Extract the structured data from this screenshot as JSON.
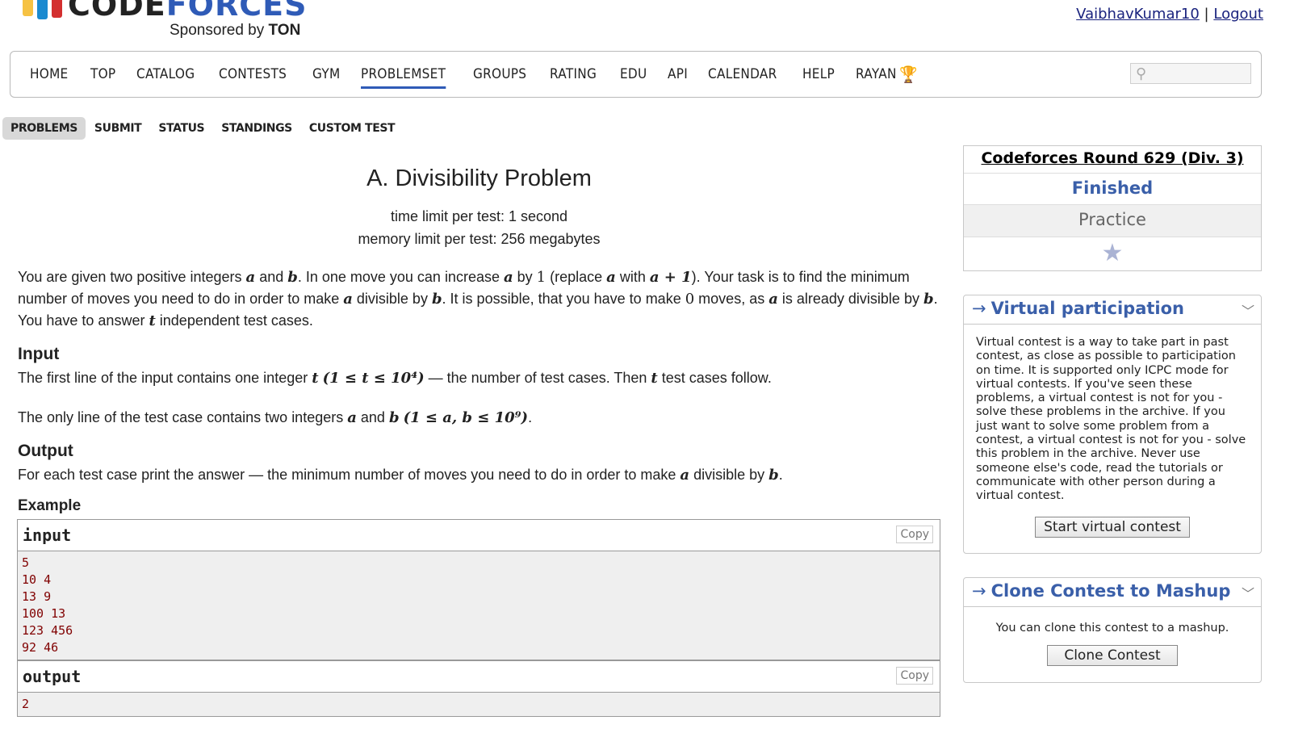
{
  "logo": {
    "code": "CODE",
    "forces": "FORCES",
    "sponsor_prefix": "Sponsored by",
    "sponsor_name": "TON"
  },
  "user": {
    "name": "VaibhavKumar10",
    "separator": "|",
    "logout": "Logout"
  },
  "nav": {
    "items": [
      "HOME",
      "TOP",
      "CATALOG",
      "CONTESTS",
      "GYM",
      "PROBLEMSET",
      "GROUPS",
      "RATING",
      "EDU",
      "API",
      "CALENDAR",
      "HELP",
      "RAYAN"
    ],
    "active": "PROBLEMSET"
  },
  "subnav": {
    "items": [
      "PROBLEMS",
      "SUBMIT",
      "STATUS",
      "STANDINGS",
      "CUSTOM TEST"
    ],
    "active": "PROBLEMS"
  },
  "problem": {
    "title": "A. Divisibility Problem",
    "time_limit": "time limit per test: 1 second",
    "memory_limit": "memory limit per test: 256 megabytes",
    "statement_parts": {
      "p1": "You are given two positive integers ",
      "a": "a",
      "and": " and ",
      "b": "b",
      "p2": ". In one move you can increase ",
      "p3": " by ",
      "one": "1",
      "p4": " (replace ",
      "p5": " with ",
      "aplus1": "a + 1",
      "p6": "). Your task is to find the minimum number of moves you need to do in order to make ",
      "p7": " divisible by ",
      "p8": ". It is possible, that you have to make ",
      "zero": "0",
      "p9": " moves, as ",
      "p10": " is already divisible by ",
      "p11": ". You have to answer ",
      "t": "t",
      "p12": " independent test cases."
    },
    "input_title": "Input",
    "input_line1_a": "The first line of the input contains one integer ",
    "input_line1_math": "(1 ≤ t ≤ 10⁴)",
    "input_line1_b": " — the number of test cases. Then ",
    "input_line1_c": " test cases follow.",
    "input_line2_a": "The only line of the test case contains two integers ",
    "input_line2_math": "(1 ≤ a, b ≤ 10⁹)",
    "input_line2_end": ".",
    "output_title": "Output",
    "output_line_a": "For each test case print the answer — the minimum number of moves you need to do in order to make ",
    "output_line_end": ".",
    "example_title": "Example",
    "input_label": "input",
    "output_label": "output",
    "copy_label": "Copy",
    "input_lines": [
      "5",
      "10 4",
      "13 9",
      "100 13",
      "123 456",
      "92 46"
    ],
    "output_first": "2"
  },
  "sidebar": {
    "round_name": "Codeforces Round 629 (Div. 3)",
    "status": "Finished",
    "mode": "Practice",
    "star_icon": "star-icon",
    "virtual": {
      "title": "Virtual participation",
      "text": "Virtual contest is a way to take part in past contest, as close as possible to participation on time. It is supported only ICPC mode for virtual contests. If you've seen these problems, a virtual contest is not for you - solve these problems in the archive. If you just want to solve some problem from a contest, a virtual contest is not for you - solve this problem in the archive. Never use someone else's code, read the tutorials or communicate with other person during a virtual contest.",
      "button": "Start virtual contest"
    },
    "clone": {
      "title": "Clone Contest to Mashup",
      "text": "You can clone this contest to a mashup.",
      "button": "Clone Contest"
    },
    "arrow": "→"
  }
}
